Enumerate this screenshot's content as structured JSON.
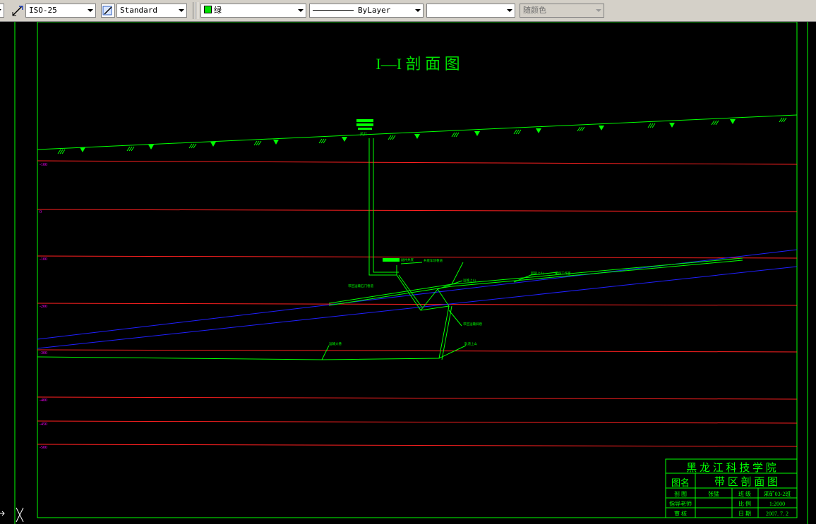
{
  "toolbar": {
    "dimstyle": "ISO-25",
    "textstyle": "Standard",
    "layer_color_label": "绿",
    "linetype": "ByLayer",
    "lineweight": "",
    "plotstyle": "随颜色"
  },
  "drawing": {
    "title": "I—I   剖 面 图",
    "elevation_labels": [
      "-100",
      "0",
      "-100",
      "-200",
      "-300",
      "-400",
      "-450",
      "-500"
    ],
    "surface_label": "风井",
    "annotations": [
      "副井井底",
      "井底车场巷道",
      "运输大巷",
      "带区运输石门巷道",
      "带区运输斜巷",
      "运输上山",
      "回风上山",
      "采煤工作面",
      "轨道上山"
    ]
  },
  "title_block": {
    "school": "黑 龙 江 科 技 学 院",
    "drawing_name_label": "图名",
    "drawing_name": "带 区 剖 面 图",
    "row1": [
      "剖 图",
      "张猛",
      "班 级",
      "采矿03-2班"
    ],
    "row2": [
      "指导老师",
      "",
      "比 例",
      "1:2000"
    ],
    "row3": [
      "审 核",
      "",
      "日 期",
      "2007. 7. 2"
    ]
  },
  "colors": {
    "background": "#000000",
    "frame": "#00ff00",
    "elevation_line": "#ff2020",
    "seam_line": "#2020ff",
    "elevation_text": "#ff00ff"
  }
}
